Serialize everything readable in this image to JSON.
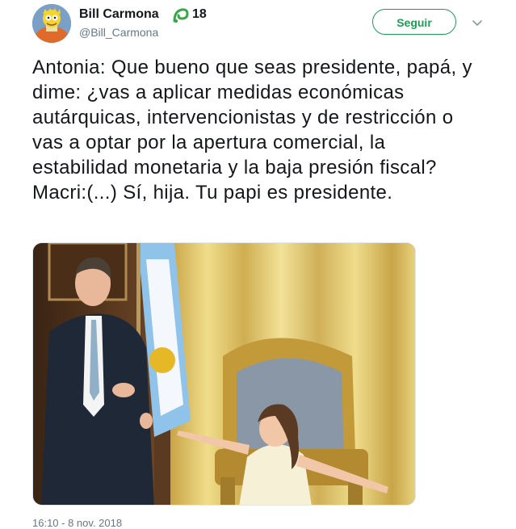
{
  "author": {
    "display_name": "Bill Carmona",
    "handle": "@Bill_Carmona",
    "badge_count": "18",
    "avatar_icon": "cartoon-avatar",
    "badge_icon": "green-leaf-badge"
  },
  "actions": {
    "follow_label": "Seguir",
    "menu_icon": "chevron-down-icon"
  },
  "tweet": {
    "lines": [
      "Antonia: Que bueno que seas presidente, papá, y dime: ¿vas a aplicar medidas económicas autárquicas, intervencionistas y de restricción o vas a optar por la apertura comercial, la estabilidad monetaria y la baja presión fiscal?",
      "Macri:(...) Sí, hija. Tu papi es presidente."
    ],
    "timestamp": "16:10 - 8 nov. 2018"
  },
  "colors": {
    "accent": "#1b9e54",
    "text": "#14171a",
    "muted": "#657786"
  }
}
